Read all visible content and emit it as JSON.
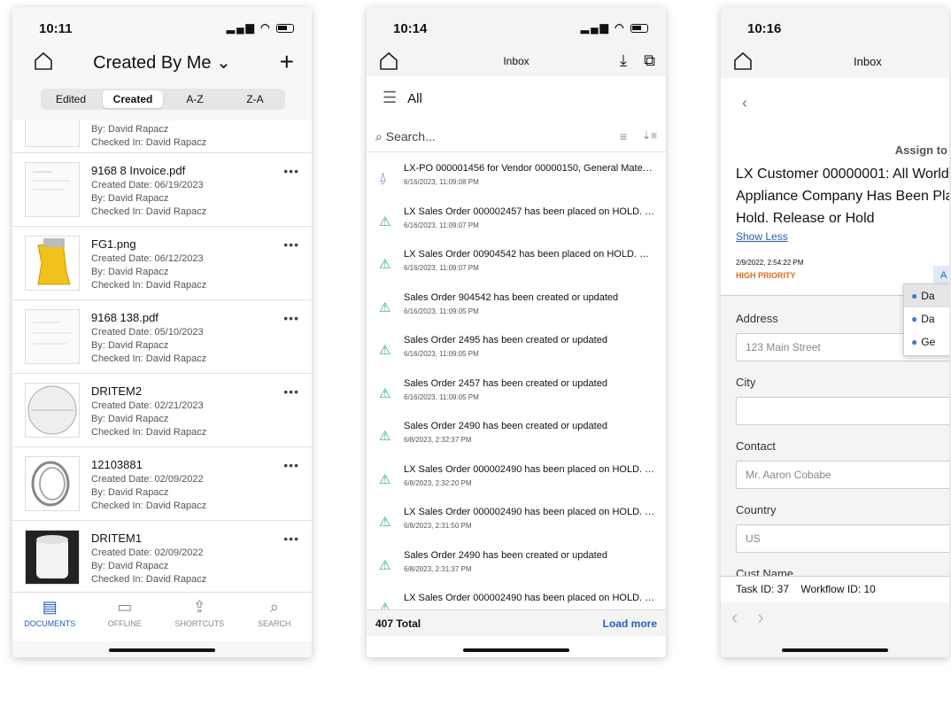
{
  "panel1": {
    "time": "10:11",
    "title": "Created By Me",
    "segments": [
      "Edited",
      "Created",
      "A-Z",
      "Z-A"
    ],
    "partial": {
      "by": "By: David Rapacz",
      "checked": "Checked In: David Rapacz"
    },
    "docs": [
      {
        "name": "9168 8 Invoice.pdf",
        "created": "Created Date: 06/19/2023",
        "by": "By: David Rapacz",
        "checked": "Checked In: David Rapacz",
        "more": "•••"
      },
      {
        "name": "FG1.png",
        "created": "Created Date: 06/12/2023",
        "by": "By: David Rapacz",
        "checked": "Checked In: David Rapacz",
        "more": "•••"
      },
      {
        "name": "9168 138.pdf",
        "created": "Created Date: 05/10/2023",
        "by": "By: David Rapacz",
        "checked": "Checked In: David Rapacz",
        "more": "•••"
      },
      {
        "name": "DRITEM2",
        "created": "Created Date: 02/21/2023",
        "by": "By: David Rapacz",
        "checked": "Checked In: David Rapacz",
        "more": "•••"
      },
      {
        "name": "12103881",
        "created": "Created Date: 02/09/2022",
        "by": "By: David Rapacz",
        "checked": "Checked In: David Rapacz",
        "more": "•••"
      },
      {
        "name": "DRITEM1",
        "created": "Created Date: 02/09/2022",
        "by": "By: David Rapacz",
        "checked": "Checked In: David Rapacz",
        "more": "•••"
      }
    ],
    "tabs": [
      "DOCUMENTS",
      "OFFLINE",
      "SHORTCUTS",
      "SEARCH"
    ]
  },
  "panel2": {
    "time": "10:14",
    "title": "Inbox",
    "filter": "All",
    "search_placeholder": "Search...",
    "items": [
      {
        "title": "LX-PO 000001456 for Vendor 00000150, General Mater…",
        "date": "6/16/2023, 11:09:08 PM",
        "icon": "bell-icon"
      },
      {
        "title": "LX Sales Order 000002457 has been placed on HOLD. …",
        "date": "6/16/2023, 11:09:07 PM",
        "icon": "warning-icon"
      },
      {
        "title": "LX Sales Order 00904542 has been placed on HOLD. C…",
        "date": "6/16/2023, 11:09:07 PM",
        "icon": "warning-icon"
      },
      {
        "title": "Sales Order 904542 has been created or updated",
        "date": "6/16/2023, 11:09:05 PM",
        "icon": "warning-icon"
      },
      {
        "title": "Sales Order 2495 has been created or updated",
        "date": "6/16/2023, 11:09:05 PM",
        "icon": "warning-icon"
      },
      {
        "title": "Sales Order 2457 has been created or updated",
        "date": "6/16/2023, 11:09:05 PM",
        "icon": "warning-icon"
      },
      {
        "title": "Sales Order 2490 has been created or updated",
        "date": "6/8/2023, 2:32:37 PM",
        "icon": "warning-icon"
      },
      {
        "title": "LX Sales Order 000002490 has been placed on HOLD. …",
        "date": "6/8/2023, 2:32:20 PM",
        "icon": "warning-icon"
      },
      {
        "title": "LX Sales Order 000002490 has been placed on HOLD. …",
        "date": "6/8/2023, 2:31:50 PM",
        "icon": "warning-icon"
      },
      {
        "title": "Sales Order 2490 has been created or updated",
        "date": "6/8/2023, 2:31:37 PM",
        "icon": "warning-icon"
      },
      {
        "title": "LX Sales Order 000002490 has been placed on HOLD. …",
        "date": "",
        "icon": "warning-icon"
      }
    ],
    "total": "407 Total",
    "load_more": "Load more"
  },
  "panel3": {
    "time": "10:16",
    "title": "Inbox",
    "assign": "Assign to",
    "subject_lines": [
      "LX Customer 00000001: All World",
      "Appliance Company Has Been Pla",
      "Hold. Release or Hold"
    ],
    "show_less": "Show Less",
    "date": "2/9/2022, 2:54:22 PM",
    "priority": "HIGH PRIORITY",
    "assign_btn": "A",
    "dropdown": [
      "Da",
      "Da",
      "Ge"
    ],
    "fields": [
      {
        "label": "Address",
        "value": "123 Main Street"
      },
      {
        "label": "City",
        "value": ""
      },
      {
        "label": "Contact",
        "value": "Mr. Aaron Cobabe"
      },
      {
        "label": "Country",
        "value": "US"
      }
    ],
    "partial_label": "Cust Name",
    "task_id": "Task ID: 37",
    "workflow_id": "Workflow ID: 10"
  }
}
